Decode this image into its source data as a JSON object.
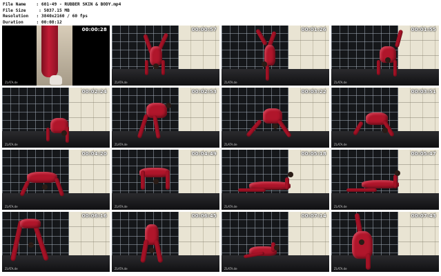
{
  "info": {
    "file_name_label": "File Name",
    "file_name_value": "601-49 - RUBBER SKIN & BODY.mp4",
    "file_size_label": "File Size",
    "file_size_value": "5037.15 MB",
    "resolution_label": "Resolution",
    "resolution_value": "3840x2160 / 60 fps",
    "duration_label": "Duration",
    "duration_value": "00:08:12"
  },
  "thumbnails": [
    {
      "time": "00:00:28",
      "watermark": "ZLATA.de"
    },
    {
      "time": "00:00:57",
      "watermark": "ZLATA.de"
    },
    {
      "time": "00:01:26",
      "watermark": "ZLATA.de"
    },
    {
      "time": "00:01:55",
      "watermark": "ZLATA.de"
    },
    {
      "time": "00:02:24",
      "watermark": "ZLATA.de"
    },
    {
      "time": "00:02:53",
      "watermark": "ZLATA.de"
    },
    {
      "time": "00:03:22",
      "watermark": "ZLATA.de"
    },
    {
      "time": "00:03:51",
      "watermark": "ZLATA.de"
    },
    {
      "time": "00:04:20",
      "watermark": "ZLATA.de"
    },
    {
      "time": "00:04:49",
      "watermark": "ZLATA.de"
    },
    {
      "time": "00:05:18",
      "watermark": "ZLATA.de"
    },
    {
      "time": "00:05:47",
      "watermark": "ZLATA.de"
    },
    {
      "time": "00:06:16",
      "watermark": "ZLATA.de"
    },
    {
      "time": "00:06:45",
      "watermark": "ZLATA.de"
    },
    {
      "time": "00:07:14",
      "watermark": "ZLATA.de"
    },
    {
      "time": "00:07:43",
      "watermark": "ZLATA.de"
    }
  ],
  "colors": {
    "suit": "#b0162b",
    "background": "#ffffff",
    "timestamp": "#ffffff"
  }
}
